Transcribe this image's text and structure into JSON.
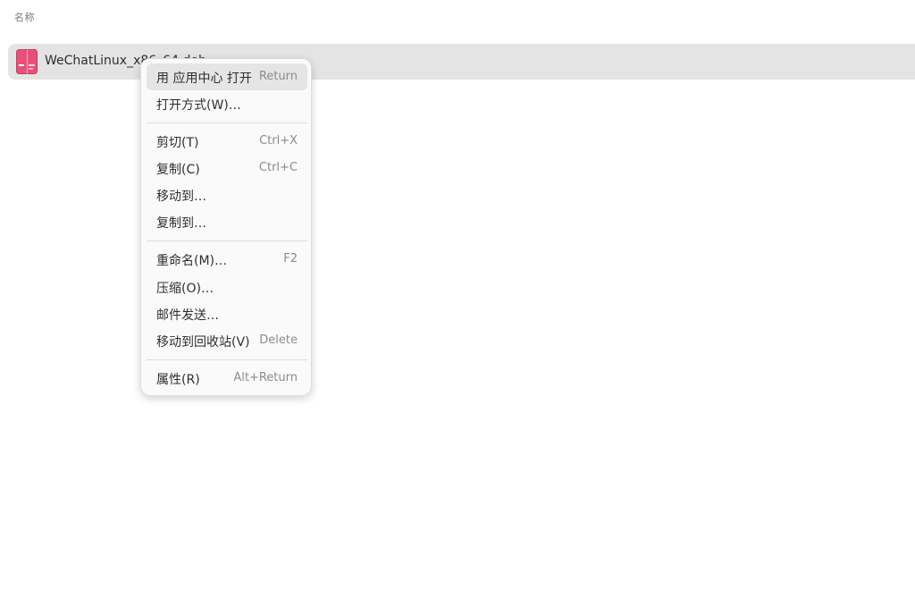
{
  "list": {
    "column_name": "名称"
  },
  "file": {
    "name": "WeChatLinux_x86_64.deb",
    "icon": "deb-package-icon",
    "icon_color": "#e8507a"
  },
  "context_menu": {
    "items": [
      {
        "label": "用 应用中心 打开",
        "accel": "Return"
      },
      {
        "label": "打开方式(W)…",
        "accel": ""
      },
      {
        "label": "剪切(T)",
        "accel": "Ctrl+X"
      },
      {
        "label": "复制(C)",
        "accel": "Ctrl+C"
      },
      {
        "label": "移动到…",
        "accel": ""
      },
      {
        "label": "复制到…",
        "accel": ""
      },
      {
        "label": "重命名(M)…",
        "accel": "F2"
      },
      {
        "label": "压缩(O)…",
        "accel": ""
      },
      {
        "label": "邮件发送…",
        "accel": ""
      },
      {
        "label": "移动到回收站(V)",
        "accel": "Delete"
      },
      {
        "label": "属性(R)",
        "accel": "Alt+Return"
      }
    ]
  },
  "colors": {
    "selection": "#e4e4e4",
    "menu_background": "#fafafa",
    "menu_hover": "#e5e5e5"
  }
}
